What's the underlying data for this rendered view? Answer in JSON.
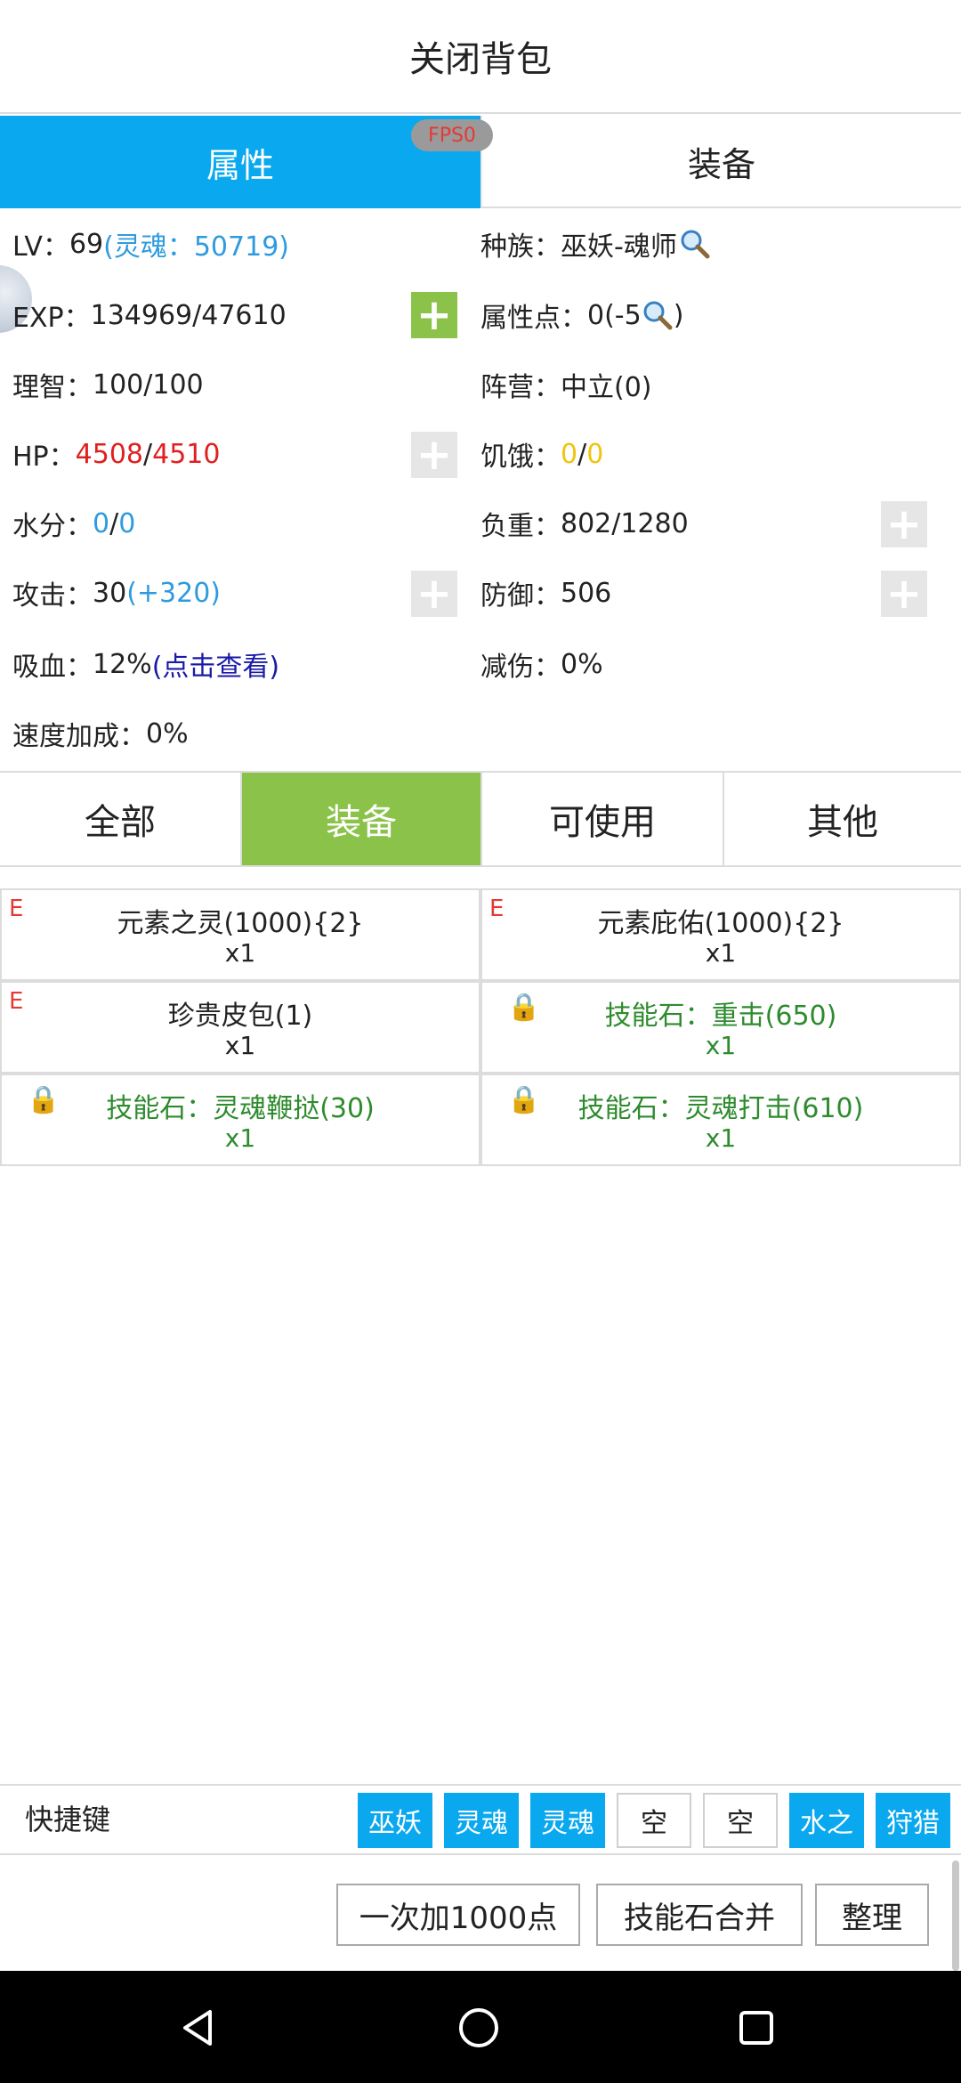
{
  "header": {
    "title": "关闭背包"
  },
  "top_tabs": [
    {
      "label": "属性",
      "active": true
    },
    {
      "label": "装备",
      "active": false
    }
  ],
  "fps_badge": "FPS0",
  "stats": {
    "lv_label": "LV：",
    "lv_value": "69",
    "lv_soul": "(灵魂：50719)",
    "race_label": "种族：",
    "race_value": "巫妖-魂师",
    "exp_label": "EXP：",
    "exp_value": "134969/47610",
    "attr_points_label": "属性点：",
    "attr_points_value": "0(-5",
    "attr_points_suffix": ")",
    "sanity_label": "理智：",
    "sanity_value": "100/100",
    "faction_label": "阵营：",
    "faction_value": "中立(0)",
    "hp_label": "HP：",
    "hp_current": "4508",
    "hp_sep": "/",
    "hp_max": "4510",
    "hunger_label": "饥饿：",
    "hunger_current": "0",
    "hunger_sep": "/",
    "hunger_max": "0",
    "water_label": "水分：",
    "water_current": "0",
    "water_sep": "/",
    "water_max": "0",
    "load_label": "负重：",
    "load_value": "802/1280",
    "attack_label": "攻击：",
    "attack_value": "30 ",
    "attack_bonus": "(+320)",
    "defense_label": "防御：",
    "defense_value": "506",
    "lifesteal_label": "吸血：",
    "lifesteal_value": "12%",
    "lifesteal_link": "(点击查看)",
    "damage_reduction_label": "减伤：",
    "damage_reduction_value": "0%",
    "speed_label": "速度加成：",
    "speed_value": "0%"
  },
  "plus_symbol": "+",
  "filter_tabs": [
    "全部",
    "装备",
    "可使用",
    "其他"
  ],
  "filter_active_index": 1,
  "items": [
    {
      "tag": "E",
      "name": "元素之灵(1000){2}",
      "qty": "x1",
      "locked": false
    },
    {
      "tag": "E",
      "name": "元素庇佑(1000){2}",
      "qty": "x1",
      "locked": false
    },
    {
      "tag": "E",
      "name": "珍贵皮包(1)",
      "qty": "x1",
      "locked": false
    },
    {
      "tag": "",
      "name": "技能石：重击(650)",
      "qty": "x1",
      "locked": true
    },
    {
      "tag": "",
      "name": "技能石：灵魂鞭挞(30)",
      "qty": "x1",
      "locked": true
    },
    {
      "tag": "",
      "name": "技能石：灵魂打击(610)",
      "qty": "x1",
      "locked": true
    }
  ],
  "shortcut": {
    "label": "快捷键",
    "slots": [
      "巫妖",
      "灵魂",
      "灵魂",
      "空",
      "空",
      "水之",
      "狩猎"
    ]
  },
  "buttons": {
    "add1000": "一次加1000点",
    "merge": "技能石合并",
    "sort": "整理"
  },
  "icons": {
    "search": "magnifier-icon",
    "lock": "lock-icon",
    "nav": [
      "back-icon",
      "home-icon",
      "recents-icon"
    ]
  },
  "colors": {
    "accent_blue": "#09a8ef",
    "accent_green": "#8bc34a",
    "hp_red": "#e02020",
    "soul_blue": "#2f9bde",
    "skill_green": "#2e8b2e"
  }
}
